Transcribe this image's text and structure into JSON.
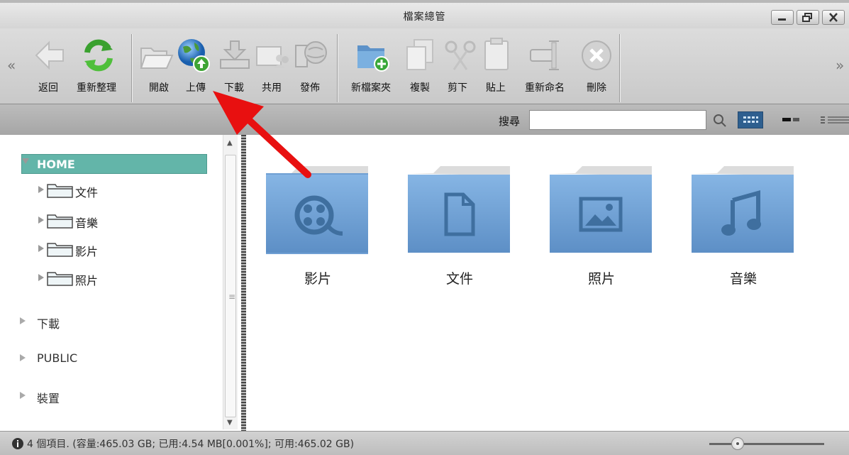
{
  "window": {
    "title": "檔案總管",
    "controls": {
      "minimize": "minimize",
      "restore": "restore",
      "close": "close"
    }
  },
  "toolbar": {
    "collapse_glyph": "«",
    "expand_glyph": "»",
    "buttons": [
      {
        "label": "返回",
        "icon": "back-arrow-icon"
      },
      {
        "label": "重新整理",
        "icon": "refresh-icon"
      },
      {
        "label": "開啟",
        "icon": "open-folder-icon"
      },
      {
        "label": "上傳",
        "icon": "upload-globe-icon"
      },
      {
        "label": "下載",
        "icon": "download-icon"
      },
      {
        "label": "共用",
        "icon": "share-icon"
      },
      {
        "label": "發佈",
        "icon": "publish-icon"
      },
      {
        "label": "新檔案夾",
        "icon": "new-folder-icon"
      },
      {
        "label": "複製",
        "icon": "copy-icon"
      },
      {
        "label": "剪下",
        "icon": "cut-icon"
      },
      {
        "label": "貼上",
        "icon": "paste-icon"
      },
      {
        "label": "重新命名",
        "icon": "rename-icon"
      },
      {
        "label": "刪除",
        "icon": "delete-icon"
      }
    ]
  },
  "search": {
    "label": "搜尋",
    "value": "",
    "placeholder": ""
  },
  "view_modes": {
    "active": "grid"
  },
  "tree": {
    "home": "HOME",
    "home_children": [
      "文件",
      "音樂",
      "影片",
      "照片"
    ],
    "roots": [
      "下載",
      "PUBLIC",
      "裝置"
    ]
  },
  "folders": [
    {
      "name": "影片",
      "type": "video",
      "icon": "film-reel-icon"
    },
    {
      "name": "文件",
      "type": "document",
      "icon": "document-icon"
    },
    {
      "name": "照片",
      "type": "photo",
      "icon": "picture-icon"
    },
    {
      "name": "音樂",
      "type": "music",
      "icon": "music-note-icon"
    }
  ],
  "status": {
    "text": "4 個項目. (容量:465.03 GB; 已用:4.54 MB[0.001%]; 可用:465.02 GB)",
    "zoom_level": 0.2
  },
  "colors": {
    "home_highlight": "#63b5a9",
    "folder_blue": "#6f9fd3",
    "annotation_arrow": "#e81010",
    "grid_view_active": "#2e5f8f"
  }
}
